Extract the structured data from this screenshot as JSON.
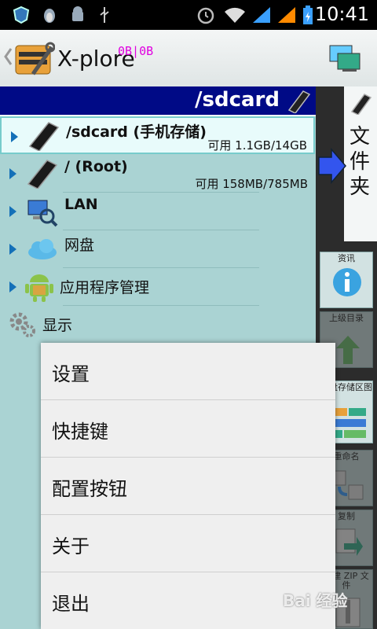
{
  "status_bar": {
    "time": "10:41"
  },
  "app": {
    "title": "X-plore",
    "stats": "0B|0B"
  },
  "path_bar": {
    "path": "/sdcard"
  },
  "drives": [
    {
      "name": "/sdcard (手机存储)",
      "free": "可用 1.1GB/14GB"
    },
    {
      "name": "/ (Root)",
      "free": "可用 158MB/785MB"
    },
    {
      "name": "LAN"
    },
    {
      "name": "网盘"
    },
    {
      "name": "应用程序管理"
    },
    {
      "name": "显示"
    }
  ],
  "right_panel": {
    "folder_tab": "文件夹",
    "buttons": [
      {
        "label": "资讯"
      },
      {
        "label": "上级目录"
      },
      {
        "label": "磁盘存储区图"
      },
      {
        "label": "重命名"
      },
      {
        "label": "复制"
      },
      {
        "label": "创建 ZIP 文件"
      }
    ]
  },
  "menu": {
    "items": [
      "设置",
      "快捷键",
      "配置按钮",
      "关于",
      "退出"
    ]
  },
  "watermark": "Bai 经验"
}
